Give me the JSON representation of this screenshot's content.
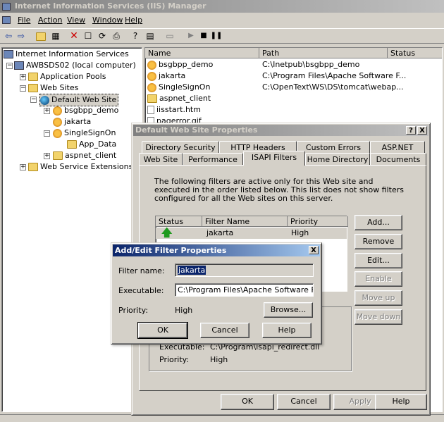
{
  "app": {
    "title": "Internet Information Services (IIS) Manager",
    "menu": [
      "File",
      "Action",
      "View",
      "Window",
      "Help"
    ]
  },
  "toolbar": {
    "icons": [
      "back-icon",
      "forward-icon",
      "up-folder-icon",
      "show-hide-tree-icon",
      "delete-icon",
      "properties-icon",
      "refresh-icon",
      "export-icon",
      "help-icon",
      "console-icon",
      "computer-icon",
      "play-icon",
      "stop-icon",
      "pause-icon"
    ]
  },
  "tree": {
    "root": "Internet Information Services",
    "computer": "AWBSDS02 (local computer)",
    "app_pools": "Application Pools",
    "web_sites": "Web Sites",
    "default_site": "Default Web Site",
    "bsgbpp": "bsgbpp_demo",
    "jakarta": "jakarta",
    "singlesignon": "SingleSignOn",
    "app_data": "App_Data",
    "aspnet_client": "aspnet_client",
    "extensions": "Web Service Extensions"
  },
  "list": {
    "headers": {
      "name": "Name",
      "path": "Path",
      "status": "Status"
    },
    "rows": [
      {
        "name": "bsgbpp_demo",
        "path": "C:\\Inetpub\\bsgbpp_demo",
        "icon": "app"
      },
      {
        "name": "jakarta",
        "path": "C:\\Program Files\\Apache Software F...",
        "icon": "app"
      },
      {
        "name": "SingleSignOn",
        "path": "C:\\OpenText\\WS\\DS\\tomcat\\webap...",
        "icon": "app"
      },
      {
        "name": "aspnet_client",
        "path": "",
        "icon": "folder"
      },
      {
        "name": "iisstart.htm",
        "path": "",
        "icon": "file"
      },
      {
        "name": "pagerror.gif",
        "path": "",
        "icon": "file"
      }
    ]
  },
  "props": {
    "title": "Default Web Site Properties",
    "help": "?",
    "close": "X",
    "tabs_back": [
      "Directory Security",
      "HTTP Headers",
      "Custom Errors",
      "ASP.NET"
    ],
    "tabs_front": [
      "Web Site",
      "Performance",
      "ISAPI Filters",
      "Home Directory",
      "Documents"
    ],
    "description": "The following filters are active only for this Web site and executed in the order listed below. This list does not show filters configured for all the Web sites on this server.",
    "table_headers": {
      "status": "Status",
      "name": "Filter Name",
      "priority": "Priority"
    },
    "filters": [
      {
        "name": "jakarta",
        "priority": "High"
      }
    ],
    "side_buttons": {
      "add": "Add...",
      "remove": "Remove",
      "edit": "Edit...",
      "enable": "Enable",
      "move_up": "Move up",
      "move_down": "Move down"
    },
    "details": {
      "executable_label": "Executable:",
      "executable_value": "C:\\Program\\isapi_redirect.dll",
      "priority_label": "Priority:",
      "priority_value": "High"
    },
    "footer": {
      "ok": "OK",
      "cancel": "Cancel",
      "apply": "Apply",
      "help": "Help"
    }
  },
  "filter_dialog": {
    "title": "Add/Edit Filter Properties",
    "close": "X",
    "name_label": "Filter name:",
    "name_value": "jakarta",
    "exe_label": "Executable:",
    "exe_value": "C:\\Program Files\\Apache Software Founda",
    "priority_label": "Priority:",
    "priority_value": "High",
    "browse": "Browse...",
    "ok": "OK",
    "cancel": "Cancel",
    "help": "Help"
  },
  "colors": {
    "title_active": "#0a246a",
    "title_inactive": "#808080",
    "face": "#d4d0c8",
    "arrow_green": "#1e9a1e"
  }
}
